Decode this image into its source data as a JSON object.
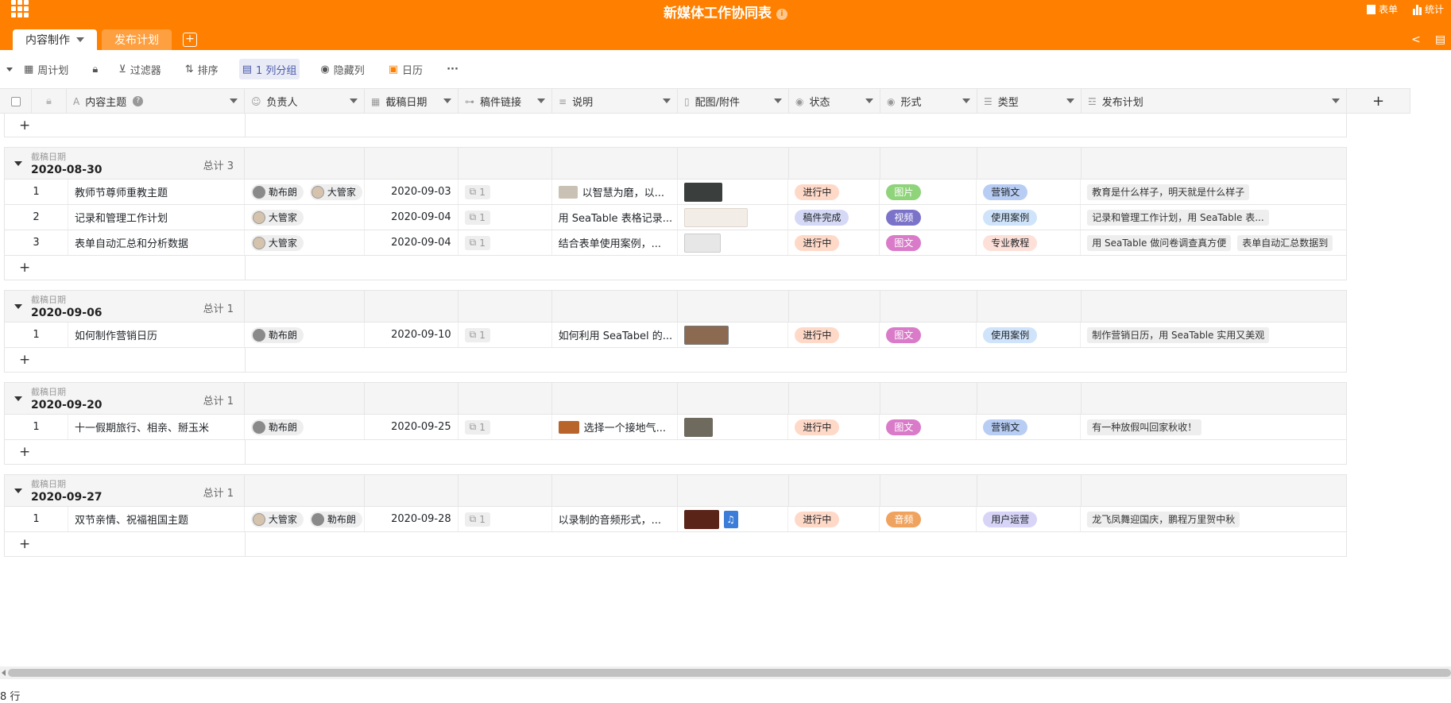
{
  "header": {
    "title": "新媒体工作协同表",
    "form_label": "表单",
    "stats_label": "统计",
    "tabs": [
      {
        "label": "内容制作",
        "active": true
      },
      {
        "label": "发布计划",
        "active": false
      }
    ]
  },
  "toolbar": {
    "view": "周计划",
    "filter": "过滤器",
    "sort": "排序",
    "group": "1 列分组",
    "hide": "隐藏列",
    "calendar": "日历",
    "more": "···"
  },
  "columns": [
    {
      "label": "内容主题",
      "icon": "text-icon"
    },
    {
      "label": "负责人",
      "icon": "user-icon"
    },
    {
      "label": "截稿日期",
      "icon": "calendar-icon"
    },
    {
      "label": "稿件链接",
      "icon": "link-icon"
    },
    {
      "label": "说明",
      "icon": "longtext-icon"
    },
    {
      "label": "配图/附件",
      "icon": "file-icon"
    },
    {
      "label": "状态",
      "icon": "select-icon"
    },
    {
      "label": "形式",
      "icon": "select-icon"
    },
    {
      "label": "类型",
      "icon": "multiselect-icon"
    },
    {
      "label": "发布计划",
      "icon": "link-records-icon"
    }
  ],
  "add_column": "+",
  "add_row": "+",
  "groups": [
    {
      "label": "截稿日期",
      "value": "2020-08-30",
      "count": "总计 3",
      "rows": [
        {
          "no": "1",
          "topic": "教师节尊师重教主题",
          "people": [
            "勒布朗",
            "大管家"
          ],
          "date": "2020-09-03",
          "link": "1",
          "desc": "以智慧为磨，以...",
          "status": "进行中",
          "form": "图片",
          "type": "营销文",
          "plans": [
            "教育是什么样子，明天就是什么样子"
          ]
        },
        {
          "no": "2",
          "topic": "记录和管理工作计划",
          "people": [
            "大管家"
          ],
          "date": "2020-09-04",
          "link": "1",
          "desc": "用 SeaTable 表格记录...",
          "status": "稿件完成",
          "form": "视频",
          "type": "使用案例",
          "plans": [
            "记录和管理工作计划，用 SeaTable 表..."
          ]
        },
        {
          "no": "3",
          "topic": "表单自动汇总和分析数据",
          "people": [
            "大管家"
          ],
          "date": "2020-09-04",
          "link": "1",
          "desc": "结合表单使用案例，...",
          "status": "进行中",
          "form": "图文",
          "type": "专业教程",
          "plans": [
            "用 SeaTable 做问卷调查真方便",
            "表单自动汇总数据到"
          ]
        }
      ]
    },
    {
      "label": "截稿日期",
      "value": "2020-09-06",
      "count": "总计 1",
      "rows": [
        {
          "no": "1",
          "topic": "如何制作营销日历",
          "people": [
            "勒布朗"
          ],
          "date": "2020-09-10",
          "link": "1",
          "desc": "如何利用 SeaTabel 的...",
          "status": "进行中",
          "form": "图文",
          "type": "使用案例",
          "plans": [
            "制作营销日历，用 SeaTable 实用又美观"
          ]
        }
      ]
    },
    {
      "label": "截稿日期",
      "value": "2020-09-20",
      "count": "总计 1",
      "rows": [
        {
          "no": "1",
          "topic": "十一假期旅行、相亲、掰玉米",
          "people": [
            "勒布朗"
          ],
          "date": "2020-09-25",
          "link": "1",
          "desc": "选择一个接地气...",
          "status": "进行中",
          "form": "图文",
          "type": "营销文",
          "plans": [
            "有一种放假叫回家秋收！"
          ]
        }
      ]
    },
    {
      "label": "截稿日期",
      "value": "2020-09-27",
      "count": "总计 1",
      "rows": [
        {
          "no": "1",
          "topic": "双节亲情、祝福祖国主题",
          "people": [
            "大管家",
            "勒布朗"
          ],
          "date": "2020-09-28",
          "link": "1",
          "desc": "以录制的音频形式，...",
          "status": "进行中",
          "form": "音频",
          "type": "用户运营",
          "plans": [
            "龙飞凤舞迎国庆，鹏程万里贺中秋"
          ]
        }
      ]
    }
  ],
  "colors": {
    "header": "#ff8000",
    "status": {
      "进行中": "#ffd9c8",
      "稿件完成": "#d6d9f5"
    },
    "form": {
      "图片": "#8fd37a",
      "视频": "#7b73c9",
      "图文": "#d97bc9",
      "音频": "#f0a35e"
    },
    "type": {
      "营销文": "#b8cdf4",
      "使用案例": "#cfe3fa",
      "专业教程": "#fde0d8",
      "用户运营": "#d7d4f7"
    }
  },
  "footer": {
    "row_count": "8 行"
  }
}
